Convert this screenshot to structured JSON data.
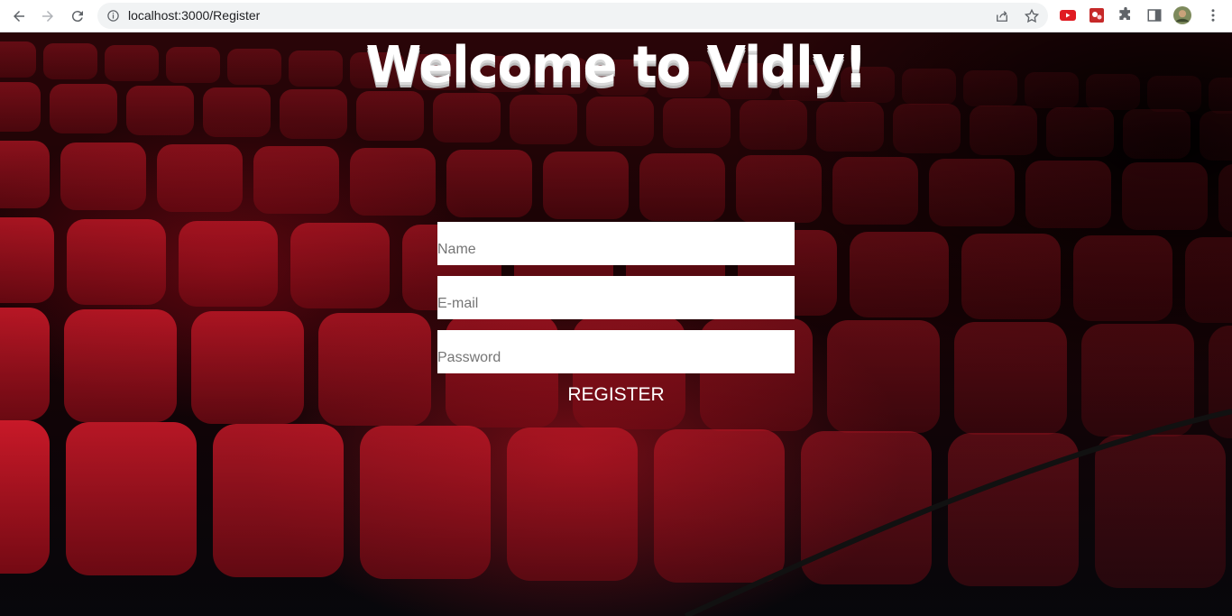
{
  "browser": {
    "url": "localhost:3000/Register"
  },
  "page": {
    "title": "Welcome to Vidly!",
    "form": {
      "name_placeholder": "Name",
      "email_placeholder": "E-mail",
      "password_placeholder": "Password",
      "register_label": "REGISTER"
    }
  }
}
